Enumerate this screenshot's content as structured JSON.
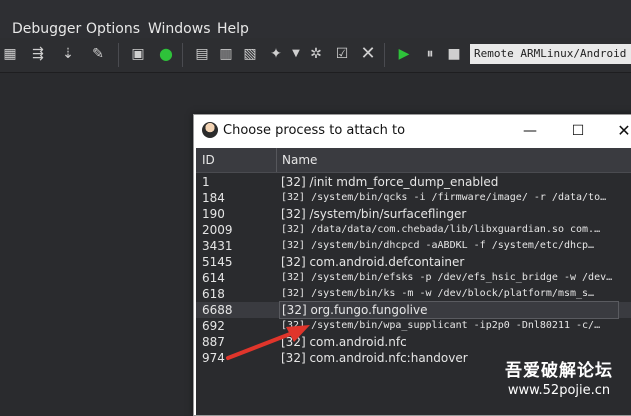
{
  "menu": [
    "Debugger",
    "Options",
    "Windows",
    "Help"
  ],
  "toolbar": {
    "remote_label": "Remote ARMLinux/Android debugger"
  },
  "dialog": {
    "title": "Choose process to attach to",
    "columns": {
      "id": "ID",
      "name": "Name"
    },
    "rows": [
      {
        "id": "1",
        "name": "[32] /init mdm_force_dump_enabled",
        "mono": false
      },
      {
        "id": "184",
        "name": "[32] /system/bin/qcks -i /firmware/image/ -r /data/to…",
        "mono": true
      },
      {
        "id": "190",
        "name": "[32] /system/bin/surfaceflinger",
        "mono": false
      },
      {
        "id": "2009",
        "name": "[32] /data/data/com.chebada/lib/libxguardian.so com.…",
        "mono": true
      },
      {
        "id": "3431",
        "name": "[32] /system/bin/dhcpcd -aABDKL -f /system/etc/dhcp…",
        "mono": true
      },
      {
        "id": "5145",
        "name": "[32] com.android.defcontainer",
        "mono": false
      },
      {
        "id": "614",
        "name": "[32] /system/bin/efsks -p /dev/efs_hsic_bridge -w /dev…",
        "mono": true
      },
      {
        "id": "618",
        "name": "[32] /system/bin/ks -m -w /dev/block/platform/msm_s…",
        "mono": true
      },
      {
        "id": "6688",
        "name": "[32] org.fungo.fungolive",
        "mono": false,
        "selected": true
      },
      {
        "id": "692",
        "name": "[32] /system/bin/wpa_supplicant -ip2p0 -Dnl80211 -c/…",
        "mono": true
      },
      {
        "id": "887",
        "name": "[32] com.android.nfc",
        "mono": false
      },
      {
        "id": "974",
        "name": "[32] com.android.nfc:handover",
        "mono": false
      }
    ]
  },
  "watermark": {
    "line1": "吾爱破解论坛",
    "line2": "www.52pojie.cn"
  },
  "colors": {
    "accent_arrow": "#e0352b",
    "run_green": "#2ec23a"
  }
}
